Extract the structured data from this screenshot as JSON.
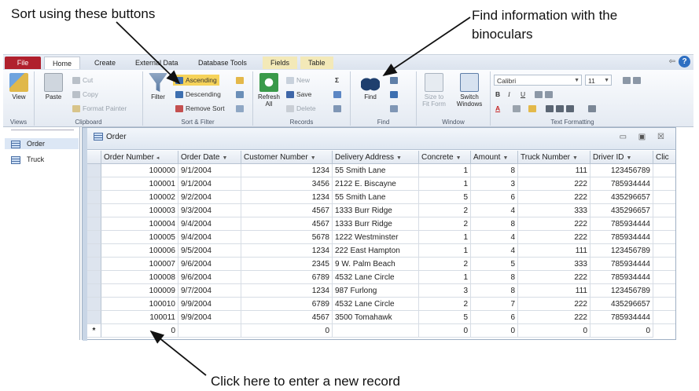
{
  "annotations": {
    "sort": "Sort using these buttons",
    "find": "Find information with the binoculars",
    "new_record": "Click here to enter a new record"
  },
  "ribbon_tabs": [
    "File",
    "Home",
    "Create",
    "External Data",
    "Database Tools",
    "Fields",
    "Table"
  ],
  "ribbon": {
    "views": {
      "view": "View",
      "label": "Views"
    },
    "clipboard": {
      "paste": "Paste",
      "cut": "Cut",
      "copy": "Copy",
      "format_painter": "Format Painter",
      "label": "Clipboard"
    },
    "sort_filter": {
      "filter": "Filter",
      "ascending": "Ascending",
      "descending": "Descending",
      "remove_sort": "Remove Sort",
      "label": "Sort & Filter"
    },
    "records": {
      "refresh": "Refresh",
      "refresh_sub": "All",
      "new": "New",
      "save": "Save",
      "delete": "Delete",
      "totals": "Σ",
      "label": "Records"
    },
    "find": {
      "find": "Find",
      "label": "Find"
    },
    "window": {
      "size_to_fit": "Size to",
      "size_to_fit_2": "Fit Form",
      "switch": "Switch",
      "switch_2": "Windows",
      "label": "Window"
    },
    "text_formatting": {
      "font": "Calibri",
      "size": "11",
      "bold": "B",
      "italic": "I",
      "underline": "U",
      "label": "Text Formatting"
    }
  },
  "nav": {
    "items": [
      "Order",
      "Truck"
    ]
  },
  "doc": {
    "title": "Order",
    "window_controls": "▭ ▣ ☒"
  },
  "table": {
    "columns": [
      "Order Number",
      "Order Date",
      "Customer Number",
      "Delivery Address",
      "Concrete",
      "Amount",
      "Truck Number",
      "Driver ID",
      "Clic"
    ],
    "rows": [
      [
        "100000",
        "9/1/2004",
        "1234",
        "55 Smith Lane",
        "1",
        "8",
        "111",
        "123456789"
      ],
      [
        "100001",
        "9/1/2004",
        "3456",
        "2122 E. Biscayne",
        "1",
        "3",
        "222",
        "785934444"
      ],
      [
        "100002",
        "9/2/2004",
        "1234",
        "55 Smith Lane",
        "5",
        "6",
        "222",
        "435296657"
      ],
      [
        "100003",
        "9/3/2004",
        "4567",
        "1333 Burr Ridge",
        "2",
        "4",
        "333",
        "435296657"
      ],
      [
        "100004",
        "9/4/2004",
        "4567",
        "1333 Burr Ridge",
        "2",
        "8",
        "222",
        "785934444"
      ],
      [
        "100005",
        "9/4/2004",
        "5678",
        "1222 Westminster",
        "1",
        "4",
        "222",
        "785934444"
      ],
      [
        "100006",
        "9/5/2004",
        "1234",
        "222 East Hampton",
        "1",
        "4",
        "111",
        "123456789"
      ],
      [
        "100007",
        "9/6/2004",
        "2345",
        "9 W. Palm Beach",
        "2",
        "5",
        "333",
        "785934444"
      ],
      [
        "100008",
        "9/6/2004",
        "6789",
        "4532 Lane Circle",
        "1",
        "8",
        "222",
        "785934444"
      ],
      [
        "100009",
        "9/7/2004",
        "1234",
        "987 Furlong",
        "3",
        "8",
        "111",
        "123456789"
      ],
      [
        "100010",
        "9/9/2004",
        "6789",
        "4532 Lane Circle",
        "2",
        "7",
        "222",
        "435296657"
      ],
      [
        "100011",
        "9/9/2004",
        "4567",
        "3500 Tomahawk",
        "5",
        "6",
        "222",
        "785934444"
      ]
    ],
    "new_row": {
      "marker": "*",
      "order_number": "0",
      "customer_number": "0",
      "concrete": "0",
      "amount": "0",
      "truck_number": "0",
      "driver_id": "0"
    }
  }
}
